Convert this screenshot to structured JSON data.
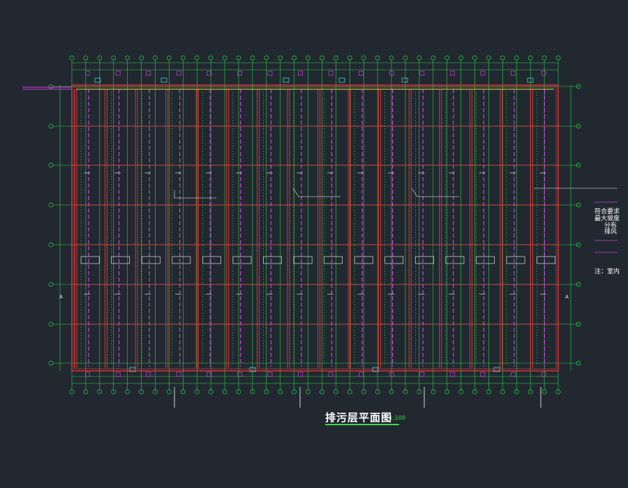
{
  "drawing": {
    "title": "排污层平面图",
    "scale": "1:100",
    "section_mark": "A",
    "notes": [
      "符合要求",
      "最大坡度",
      "分布",
      "排风",
      "注：室内"
    ]
  },
  "palette": {
    "background": "#212830",
    "grid": "#2cd64a",
    "wall": "#ff3b3b",
    "pipe": "#d23ee0",
    "accent": "#3fd0d8",
    "label": "#ffffff"
  },
  "grid_counts": {
    "columns": 36,
    "rows": 8
  }
}
